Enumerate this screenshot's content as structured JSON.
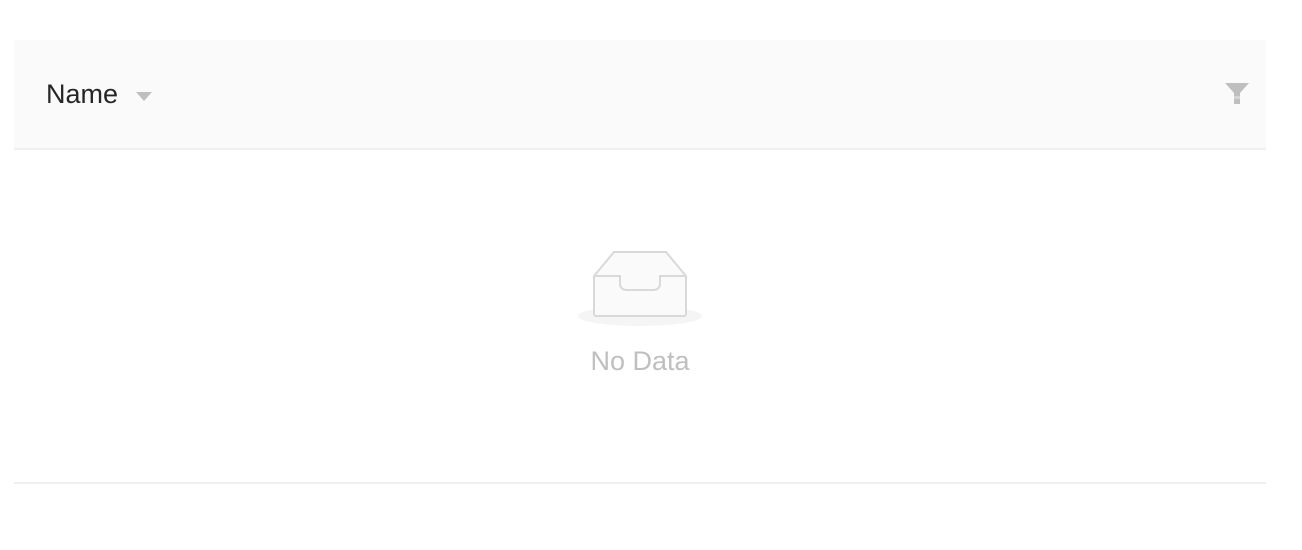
{
  "table": {
    "columns": [
      {
        "title": "Name"
      }
    ],
    "empty_text": "No Data"
  },
  "icons": {
    "sort": "caret-down-icon",
    "filter": "filter-icon",
    "empty": "inbox-icon"
  },
  "colors": {
    "header_bg": "#fafafa",
    "header_text": "#262626",
    "muted": "#bfbfbf",
    "border": "#f0f0f0"
  }
}
